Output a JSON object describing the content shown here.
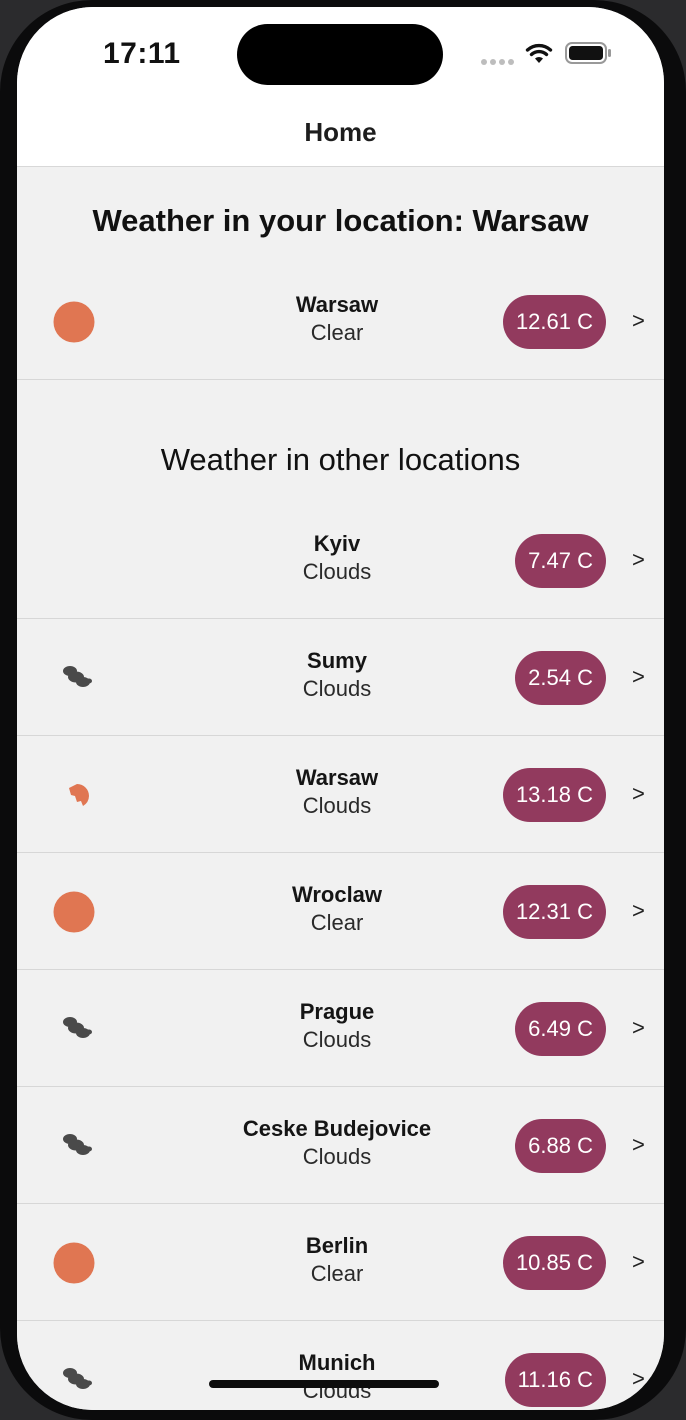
{
  "status_bar": {
    "time": "17:11"
  },
  "nav": {
    "title": "Home"
  },
  "current_section": {
    "title": "Weather in your location: Warsaw"
  },
  "current": {
    "city": "Warsaw",
    "condition": "Clear",
    "temperature": "12.61 C",
    "icon": "sun-icon",
    "chevron": ">"
  },
  "other_section": {
    "title": "Weather in other locations"
  },
  "locations": [
    {
      "city": "Kyiv",
      "condition": "Clouds",
      "temperature": "7.47 C",
      "icon": "none",
      "chevron": ">"
    },
    {
      "city": "Sumy",
      "condition": "Clouds",
      "temperature": "2.54 C",
      "icon": "dark-clouds-icon",
      "chevron": ">"
    },
    {
      "city": "Warsaw",
      "condition": "Clouds",
      "temperature": "13.18 C",
      "icon": "partly-cloudy-icon",
      "chevron": ">"
    },
    {
      "city": "Wroclaw",
      "condition": "Clear",
      "temperature": "12.31 C",
      "icon": "sun-icon",
      "chevron": ">"
    },
    {
      "city": "Prague",
      "condition": "Clouds",
      "temperature": "6.49 C",
      "icon": "dark-clouds-icon",
      "chevron": ">"
    },
    {
      "city": "Ceske Budejovice",
      "condition": "Clouds",
      "temperature": "6.88 C",
      "icon": "dark-clouds-icon",
      "chevron": ">"
    },
    {
      "city": "Berlin",
      "condition": "Clear",
      "temperature": "10.85 C",
      "icon": "sun-icon",
      "chevron": ">"
    },
    {
      "city": "Munich",
      "condition": "Clouds",
      "temperature": "11.16 C",
      "icon": "dark-clouds-icon",
      "chevron": ">"
    }
  ],
  "colors": {
    "pill": "#923a5e",
    "sun": "#e07652",
    "cloud": "#4a4a4a"
  }
}
